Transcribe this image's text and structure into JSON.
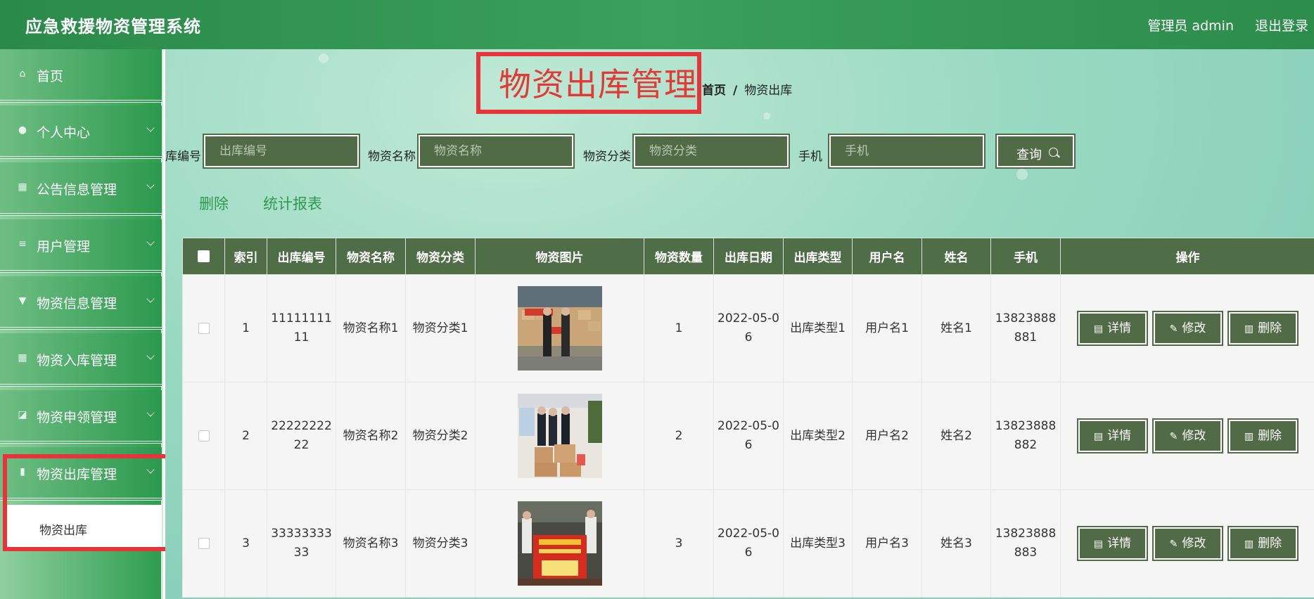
{
  "header": {
    "app_title": "应急救援物资管理系统",
    "admin_label": "管理员 admin",
    "logout_label": "退出登录"
  },
  "sidebar": {
    "items": [
      {
        "label": "首页",
        "icon": "home-icon",
        "has_arrow": false
      },
      {
        "label": "个人中心",
        "icon": "user-icon",
        "has_arrow": true
      },
      {
        "label": "公告信息管理",
        "icon": "grid-icon",
        "has_arrow": true
      },
      {
        "label": "用户管理",
        "icon": "list-icon",
        "has_arrow": true
      },
      {
        "label": "物资信息管理",
        "icon": "brush-icon",
        "has_arrow": true
      },
      {
        "label": "物资入库管理",
        "icon": "grid-icon",
        "has_arrow": true
      },
      {
        "label": "物资申领管理",
        "icon": "chart-icon",
        "has_arrow": true
      },
      {
        "label": "物资出库管理",
        "icon": "bars-icon",
        "has_arrow": true
      }
    ],
    "subitem_label": "物资出库"
  },
  "main": {
    "page_title": "物资出库管理",
    "breadcrumb": {
      "home": "首页",
      "separator": "/",
      "current": "物资出库"
    },
    "search": {
      "fields": [
        {
          "label": "出库编号",
          "placeholder": "出库编号"
        },
        {
          "label": "物资名称",
          "placeholder": "物资名称"
        },
        {
          "label": "物资分类",
          "placeholder": "物资分类"
        },
        {
          "label": "手机",
          "placeholder": "手机"
        }
      ],
      "query_label": "查询"
    },
    "actions": {
      "delete_label": "删除",
      "report_label": "统计报表"
    },
    "table": {
      "columns": [
        "索引",
        "出库编号",
        "物资名称",
        "物资分类",
        "物资图片",
        "物资数量",
        "出库日期",
        "出库类型",
        "用户名",
        "姓名",
        "手机",
        "操作"
      ],
      "rows": [
        {
          "index": "1",
          "code": "1111111111",
          "name": "物资名称1",
          "category": "物资分类1",
          "qty": "1",
          "date": "2022-05-06",
          "type": "出库类型1",
          "username": "用户名1",
          "realname": "姓名1",
          "phone": "13823888881"
        },
        {
          "index": "2",
          "code": "2222222222",
          "name": "物资名称2",
          "category": "物资分类2",
          "qty": "2",
          "date": "2022-05-06",
          "type": "出库类型2",
          "username": "用户名2",
          "realname": "姓名2",
          "phone": "13823888882"
        },
        {
          "index": "3",
          "code": "3333333333",
          "name": "物资名称3",
          "category": "物资分类3",
          "qty": "3",
          "date": "2022-05-06",
          "type": "出库类型3",
          "username": "用户名3",
          "realname": "姓名3",
          "phone": "13823888883"
        }
      ],
      "row_buttons": {
        "detail": "详情",
        "edit": "修改",
        "delete": "删除"
      }
    }
  },
  "colors": {
    "header_green": "#2f9a4f",
    "table_header": "#4f6d47",
    "button_bg": "#516b47",
    "title_red": "#e23b35",
    "link_green": "#2f9a4d"
  }
}
